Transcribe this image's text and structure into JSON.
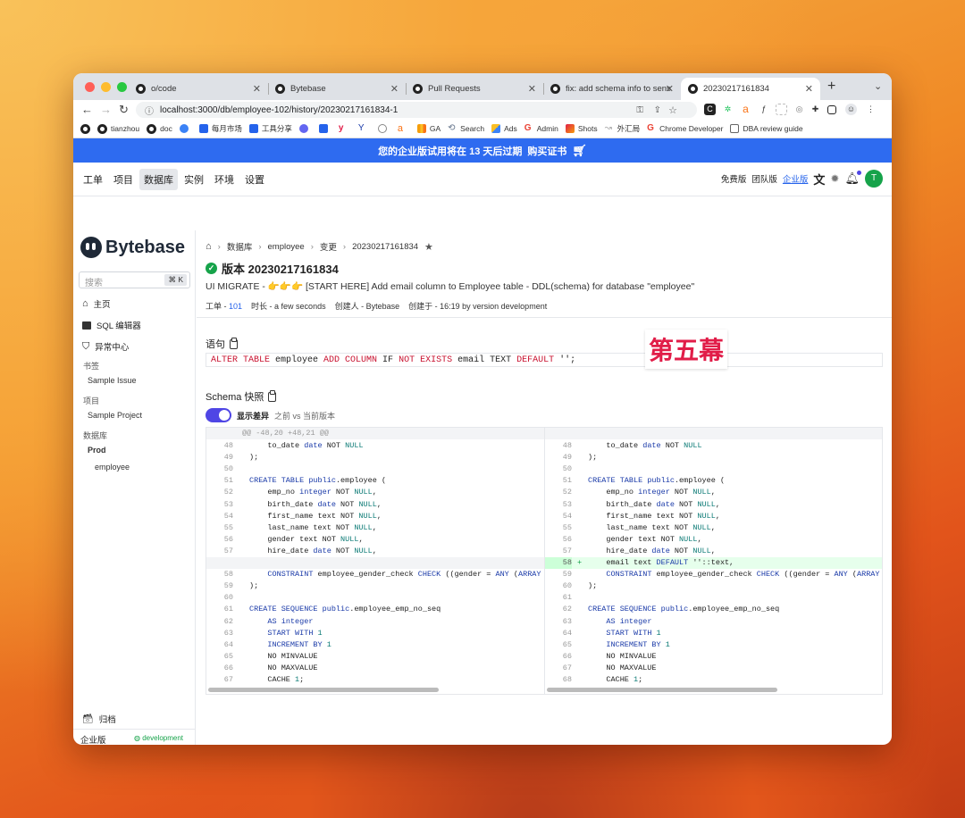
{
  "browser": {
    "tabs": [
      {
        "label": "o/code"
      },
      {
        "label": "Bytebase"
      },
      {
        "label": "Pull Requests"
      },
      {
        "label": "fix: add schema info to sensiti"
      },
      {
        "label": "20230217161834"
      }
    ],
    "new_tab": "+",
    "url": "localhost:3000/db/employee-102/history/20230217161834-1",
    "bookmarks": [
      {
        "label": "tianzhou",
        "color": "#222"
      },
      {
        "label": "doc",
        "color": "#222"
      },
      {
        "label": "",
        "color": "#3b82f6"
      },
      {
        "label": "每月市场",
        "color": "#2563eb"
      },
      {
        "label": "工具分享",
        "color": "#2563eb"
      },
      {
        "label": "",
        "color": "#6366f1"
      },
      {
        "label": "",
        "color": "#2563eb"
      },
      {
        "label": "",
        "color": "#e11d48"
      },
      {
        "label": "",
        "color": "#1a3aa8"
      },
      {
        "label": "",
        "color": "#888"
      },
      {
        "label": "",
        "color": "#f97316"
      },
      {
        "label": "GA",
        "color": "#f59e0b"
      },
      {
        "label": "Search",
        "color": "#64748b"
      },
      {
        "label": "Ads",
        "color": "#3b82f6"
      },
      {
        "label": "Admin",
        "color": "#ea4335"
      },
      {
        "label": "Shots",
        "color": "#e11d48"
      },
      {
        "label": "外汇局",
        "color": "#aaa"
      },
      {
        "label": "Chrome Developer",
        "color": "#ea4335"
      },
      {
        "label": "DBA review guide",
        "color": "#888"
      }
    ]
  },
  "banner": {
    "text": "您的企业版试用将在 13 天后过期",
    "link": "购买证书"
  },
  "nav": {
    "items": [
      "工单",
      "项目",
      "数据库",
      "实例",
      "环境",
      "设置"
    ],
    "selected": "数据库",
    "plans": [
      "免费版",
      "团队版",
      "企业版"
    ],
    "avatar": "T"
  },
  "sidebar": {
    "logo": "Bytebase",
    "search_placeholder": "搜索",
    "search_shortcut": "⌘ K",
    "home": "主页",
    "sql_editor": "SQL 编辑器",
    "anomaly": "异常中心",
    "bookmark_header": "书签",
    "bookmark_item": "Sample Issue",
    "project_header": "项目",
    "project_item": "Sample Project",
    "db_header": "数据库",
    "env": "Prod",
    "db": "employee",
    "archive": "归档",
    "edition": "企业版",
    "env_badge": "development"
  },
  "main": {
    "crumbs": [
      "数据库",
      "employee",
      "变更",
      "20230217161834"
    ],
    "title": "版本 20230217161834",
    "issue_line": "UI MIGRATE - 👉👉👉 [START HERE] Add email column to Employee table - DDL(schema) for database \"employee\"",
    "meta": {
      "issue_label": "工单 -",
      "issue_no": "101",
      "duration": "时长 - a few seconds",
      "creator": "创建人 - Bytebase",
      "created": "创建于 - 16:19 by version development"
    },
    "statement_label": "语句",
    "statement": "ALTER TABLE employee ADD COLUMN IF NOT EXISTS email TEXT DEFAULT '';",
    "act_label": "第五幕",
    "schema_label": "Schema 快照",
    "toggle_label": "显示差异",
    "toggle_desc": "之前 vs 当前版本"
  },
  "diff": {
    "hunk": "@@ -48,20 +48,21 @@",
    "left": [
      {
        "n": "48",
        "t": "    to_date date NOT NULL"
      },
      {
        "n": "49",
        "t": ");"
      },
      {
        "n": "50",
        "t": ""
      },
      {
        "n": "51",
        "t": "CREATE TABLE public.employee ("
      },
      {
        "n": "52",
        "t": "    emp_no integer NOT NULL,"
      },
      {
        "n": "53",
        "t": "    birth_date date NOT NULL,"
      },
      {
        "n": "54",
        "t": "    first_name text NOT NULL,"
      },
      {
        "n": "55",
        "t": "    last_name text NOT NULL,"
      },
      {
        "n": "56",
        "t": "    gender text NOT NULL,"
      },
      {
        "n": "57",
        "t": "    hire_date date NOT NULL,"
      },
      {
        "n": "",
        "t": "",
        "empty": true
      },
      {
        "n": "58",
        "t": "    CONSTRAINT employee_gender_check CHECK ((gender = ANY (ARRAY"
      },
      {
        "n": "59",
        "t": ");"
      },
      {
        "n": "60",
        "t": ""
      },
      {
        "n": "61",
        "t": "CREATE SEQUENCE public.employee_emp_no_seq"
      },
      {
        "n": "62",
        "t": "    AS integer"
      },
      {
        "n": "63",
        "t": "    START WITH 1"
      },
      {
        "n": "64",
        "t": "    INCREMENT BY 1"
      },
      {
        "n": "65",
        "t": "    NO MINVALUE"
      },
      {
        "n": "66",
        "t": "    NO MAXVALUE"
      },
      {
        "n": "67",
        "t": "    CACHE 1;"
      }
    ],
    "right": [
      {
        "n": "48",
        "t": "    to_date date NOT NULL"
      },
      {
        "n": "49",
        "t": ");"
      },
      {
        "n": "50",
        "t": ""
      },
      {
        "n": "51",
        "t": "CREATE TABLE public.employee ("
      },
      {
        "n": "52",
        "t": "    emp_no integer NOT NULL,"
      },
      {
        "n": "53",
        "t": "    birth_date date NOT NULL,"
      },
      {
        "n": "54",
        "t": "    first_name text NOT NULL,"
      },
      {
        "n": "55",
        "t": "    last_name text NOT NULL,"
      },
      {
        "n": "56",
        "t": "    gender text NOT NULL,"
      },
      {
        "n": "57",
        "t": "    hire_date date NOT NULL,"
      },
      {
        "n": "58",
        "t": "    email text DEFAULT ''::text,",
        "added": true
      },
      {
        "n": "59",
        "t": "    CONSTRAINT employee_gender_check CHECK ((gender = ANY (ARRAY"
      },
      {
        "n": "60",
        "t": ");"
      },
      {
        "n": "61",
        "t": ""
      },
      {
        "n": "62",
        "t": "CREATE SEQUENCE public.employee_emp_no_seq"
      },
      {
        "n": "63",
        "t": "    AS integer"
      },
      {
        "n": "64",
        "t": "    START WITH 1"
      },
      {
        "n": "65",
        "t": "    INCREMENT BY 1"
      },
      {
        "n": "66",
        "t": "    NO MINVALUE"
      },
      {
        "n": "67",
        "t": "    NO MAXVALUE"
      },
      {
        "n": "68",
        "t": "    CACHE 1;"
      }
    ],
    "add_sign": "+"
  },
  "colors": {
    "accent": "#2e6bf0",
    "toggle": "#4f46e5",
    "success": "#16a34a",
    "avatar": "#16a34a"
  }
}
